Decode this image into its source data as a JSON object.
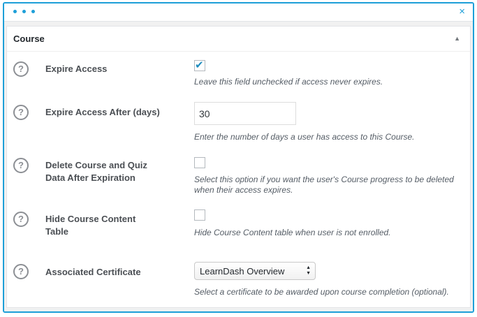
{
  "window": {
    "close_glyph": "×",
    "dots_icon": "ellipsis-icon"
  },
  "panel": {
    "title": "Course",
    "toggle_glyph": "▲"
  },
  "rows": [
    {
      "label": "Expire Access",
      "help_glyph": "?",
      "control": "checkbox",
      "checked": true,
      "description": "Leave this field unchecked if access never expires."
    },
    {
      "label": "Expire Access After (days)",
      "help_glyph": "?",
      "control": "number",
      "value": "30",
      "description": "Enter the number of days a user has access to this Course."
    },
    {
      "label": "Delete Course and Quiz Data After Expiration",
      "help_glyph": "?",
      "control": "checkbox",
      "checked": false,
      "description": "Select this option if you want the user's Course progress to be deleted when their access expires."
    },
    {
      "label": "Hide Course Content Table",
      "help_glyph": "?",
      "control": "checkbox",
      "checked": false,
      "description": "Hide Course Content table when user is not enrolled."
    },
    {
      "label": "Associated Certificate",
      "help_glyph": "?",
      "control": "select",
      "value": "LearnDash Overview",
      "description": "Select a certificate to be awarded upon course completion (optional)."
    }
  ],
  "colors": {
    "accent": "#1e9fd8",
    "check": "#1e8cbe"
  }
}
